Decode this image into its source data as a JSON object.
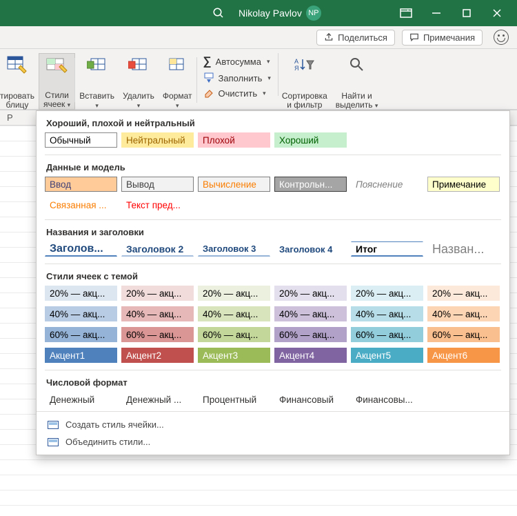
{
  "titlebar": {
    "username": "Nikolay Pavlov",
    "initials": "NP"
  },
  "actionbar": {
    "share": "Поделиться",
    "comments": "Примечания"
  },
  "ribbon": {
    "format_table": "тировать\nблицу",
    "cell_styles": "Стили\nячеек",
    "insert": "Вставить",
    "delete": "Удалить",
    "format": "Формат",
    "autosum": "Автосумма",
    "fill": "Заполнить",
    "clear": "Очистить",
    "sort_filter": "Сортировка\nи фильтр",
    "find_select": "Найти и\nвыделить"
  },
  "sheet": {
    "col": "P"
  },
  "gallery": {
    "cat1": "Хороший, плохой и нейтральный",
    "row1": [
      {
        "t": "Обычный",
        "bg": "#ffffff",
        "fg": "#000",
        "sel": true
      },
      {
        "t": "Нейтральный",
        "bg": "#ffeb9c",
        "fg": "#9c6500"
      },
      {
        "t": "Плохой",
        "bg": "#ffc7ce",
        "fg": "#9c0006"
      },
      {
        "t": "Хороший",
        "bg": "#c6efce",
        "fg": "#006100"
      }
    ],
    "cat2": "Данные и модель",
    "row2a": [
      {
        "t": "Ввод",
        "bg": "#ffcc99",
        "fg": "#3f3f76",
        "bd": "#7f7f7f"
      },
      {
        "t": "Вывод",
        "bg": "#f2f2f2",
        "fg": "#3f3f3f",
        "bd": "#7f7f7f"
      },
      {
        "t": "Вычисление",
        "bg": "#f2f2f2",
        "fg": "#fa7d00",
        "bd": "#7f7f7f"
      },
      {
        "t": "Контрольн...",
        "bg": "#a5a5a5",
        "fg": "#ffffff",
        "bd": "#3f3f3f"
      },
      {
        "t": "Пояснение",
        "bg": "#ffffff",
        "fg": "#7f7f7f",
        "it": true
      },
      {
        "t": "Примечание",
        "bg": "#ffffcc",
        "fg": "#000",
        "bd": "#b2b2b2"
      }
    ],
    "row2b": [
      {
        "t": "Связанная ...",
        "bg": "#ffffff",
        "fg": "#fa7d00"
      },
      {
        "t": "Текст пред...",
        "bg": "#ffffff",
        "fg": "#ff0000"
      }
    ],
    "cat3": "Названия и заголовки",
    "row3": [
      {
        "t": "Заголов...",
        "fg": "#1f497d",
        "fs": "16px",
        "fw": "600",
        "ub": "#4f81bd"
      },
      {
        "t": "Заголовок 2",
        "fg": "#1f497d",
        "fs": "14px",
        "fw": "600",
        "ub": "#a7bfde"
      },
      {
        "t": "Заголовок 3",
        "fg": "#1f497d",
        "fs": "13px",
        "fw": "600",
        "ub": "#95b3d7"
      },
      {
        "t": "Заголовок 4",
        "fg": "#1f497d",
        "fs": "13px",
        "fw": "600"
      },
      {
        "t": "Итог",
        "fg": "#000",
        "fs": "14px",
        "fw": "700",
        "ut": "#4f81bd",
        "ub": "#4f81bd"
      },
      {
        "t": "Назван...",
        "fg": "#808080",
        "fs": "18px"
      }
    ],
    "cat4": "Стили ячеек с темой",
    "theme_labels": [
      "20% — акц...",
      "40% — акц...",
      "60% — акц...",
      "Акцент"
    ],
    "theme": [
      [
        "#dce6f1",
        "#b8cce4",
        "#95b3d7",
        "#4f81bd"
      ],
      [
        "#f2dcdb",
        "#e6b8b7",
        "#da9694",
        "#c0504d"
      ],
      [
        "#ebf1de",
        "#d8e4bc",
        "#c4d79b",
        "#9bbb59"
      ],
      [
        "#e4dfec",
        "#ccc0da",
        "#b1a0c7",
        "#8064a2"
      ],
      [
        "#daeef3",
        "#b7dee8",
        "#92cddc",
        "#4bacc6"
      ],
      [
        "#fde9d9",
        "#fcd5b4",
        "#fabf8f",
        "#f79646"
      ]
    ],
    "accent_labels": [
      "Акцент1",
      "Акцент2",
      "Акцент3",
      "Акцент4",
      "Акцент5",
      "Акцент6"
    ],
    "cat5": "Числовой формат",
    "row5": [
      {
        "t": "Денежный"
      },
      {
        "t": "Денежный ..."
      },
      {
        "t": "Процентный"
      },
      {
        "t": "Финансовый"
      },
      {
        "t": "Финансовы..."
      }
    ],
    "foot1": "Создать стиль ячейки...",
    "foot2": "Объединить стили..."
  }
}
